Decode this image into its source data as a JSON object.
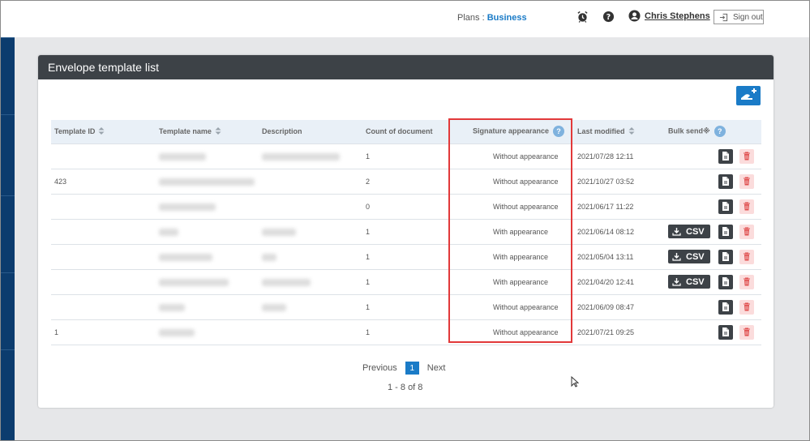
{
  "header": {
    "plans_label": "Plans :",
    "plans_value": "Business",
    "user_name": "Chris Stephens",
    "signout_label": "Sign out"
  },
  "panel": {
    "title": "Envelope template list"
  },
  "table": {
    "columns": [
      {
        "label": "Template ID"
      },
      {
        "label": "Template name"
      },
      {
        "label": "Description"
      },
      {
        "label": "Count of document"
      },
      {
        "label": "Signature appearance"
      },
      {
        "label": "Last modified"
      },
      {
        "label": "Bulk send※"
      }
    ],
    "rows": [
      {
        "id": "",
        "count": "1",
        "appearance": "Without appearance",
        "modified": "2021/07/28 12:11",
        "csv": false
      },
      {
        "id": "423",
        "count": "2",
        "appearance": "Without appearance",
        "modified": "2021/10/27 03:52",
        "csv": false
      },
      {
        "id": "",
        "count": "0",
        "appearance": "Without appearance",
        "modified": "2021/06/17 11:22",
        "csv": false
      },
      {
        "id": "",
        "count": "1",
        "appearance": "With appearance",
        "modified": "2021/06/14 08:12",
        "csv": true
      },
      {
        "id": "",
        "count": "1",
        "appearance": "With appearance",
        "modified": "2021/05/04 13:11",
        "csv": true
      },
      {
        "id": "",
        "count": "1",
        "appearance": "With appearance",
        "modified": "2021/04/20 12:41",
        "csv": true
      },
      {
        "id": "",
        "count": "1",
        "appearance": "Without appearance",
        "modified": "2021/06/09 08:47",
        "csv": false
      },
      {
        "id": "1",
        "count": "1",
        "appearance": "Without appearance",
        "modified": "2021/07/21 09:25",
        "csv": false
      }
    ],
    "csv_label": "CSV",
    "help_glyph": "?"
  },
  "pagination": {
    "previous": "Previous",
    "current": "1",
    "next": "Next",
    "summary": "1 - 8 of 8"
  },
  "colors": {
    "accent": "#1a7bc7",
    "dark": "#3d4247",
    "highlight": "#e2393a"
  }
}
